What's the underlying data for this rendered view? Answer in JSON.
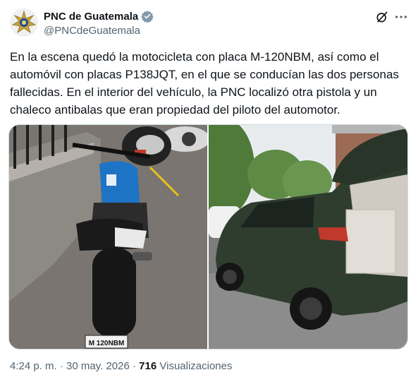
{
  "author": {
    "name": "PNC de Guatemala",
    "handle": "@PNCdeGuatemala",
    "verified": true
  },
  "tweet": {
    "text": "En la escena quedó la motocicleta con placa M-120NBM, así como el automóvil con placas P138JQT, en el que se conducían las dos personas fallecidas. En el interior del vehículo, la PNC localizó otra pistola y un chaleco antibalas que eran propiedad del piloto del automotor."
  },
  "media": {
    "photos": [
      {
        "description": "motorcycle parked by a wall",
        "plate": "M 120NBM"
      },
      {
        "description": "dark SUV with open trunk on a street"
      }
    ]
  },
  "meta": {
    "time": "4:24 p. m.",
    "separator": "·",
    "date": "30 may. 2026",
    "views_count": "716",
    "views_label": "Visualizaciones"
  },
  "icons": {
    "grok": "grok-icon",
    "more": "more-icon",
    "verified": "verified-badge-icon"
  },
  "colors": {
    "text": "#0f1419",
    "secondary": "#536471",
    "verified": "#829aab"
  }
}
